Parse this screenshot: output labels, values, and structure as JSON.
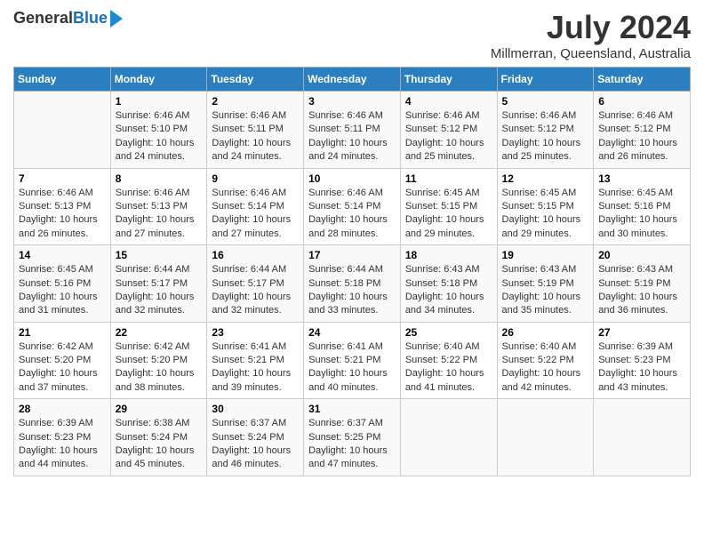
{
  "header": {
    "logo_general": "General",
    "logo_blue": "Blue",
    "month_title": "July 2024",
    "location": "Millmerran, Queensland, Australia"
  },
  "days_of_week": [
    "Sunday",
    "Monday",
    "Tuesday",
    "Wednesday",
    "Thursday",
    "Friday",
    "Saturday"
  ],
  "weeks": [
    [
      {
        "day": "",
        "info": ""
      },
      {
        "day": "1",
        "info": "Sunrise: 6:46 AM\nSunset: 5:10 PM\nDaylight: 10 hours\nand 24 minutes."
      },
      {
        "day": "2",
        "info": "Sunrise: 6:46 AM\nSunset: 5:11 PM\nDaylight: 10 hours\nand 24 minutes."
      },
      {
        "day": "3",
        "info": "Sunrise: 6:46 AM\nSunset: 5:11 PM\nDaylight: 10 hours\nand 24 minutes."
      },
      {
        "day": "4",
        "info": "Sunrise: 6:46 AM\nSunset: 5:12 PM\nDaylight: 10 hours\nand 25 minutes."
      },
      {
        "day": "5",
        "info": "Sunrise: 6:46 AM\nSunset: 5:12 PM\nDaylight: 10 hours\nand 25 minutes."
      },
      {
        "day": "6",
        "info": "Sunrise: 6:46 AM\nSunset: 5:12 PM\nDaylight: 10 hours\nand 26 minutes."
      }
    ],
    [
      {
        "day": "7",
        "info": "Sunrise: 6:46 AM\nSunset: 5:13 PM\nDaylight: 10 hours\nand 26 minutes."
      },
      {
        "day": "8",
        "info": "Sunrise: 6:46 AM\nSunset: 5:13 PM\nDaylight: 10 hours\nand 27 minutes."
      },
      {
        "day": "9",
        "info": "Sunrise: 6:46 AM\nSunset: 5:14 PM\nDaylight: 10 hours\nand 27 minutes."
      },
      {
        "day": "10",
        "info": "Sunrise: 6:46 AM\nSunset: 5:14 PM\nDaylight: 10 hours\nand 28 minutes."
      },
      {
        "day": "11",
        "info": "Sunrise: 6:45 AM\nSunset: 5:15 PM\nDaylight: 10 hours\nand 29 minutes."
      },
      {
        "day": "12",
        "info": "Sunrise: 6:45 AM\nSunset: 5:15 PM\nDaylight: 10 hours\nand 29 minutes."
      },
      {
        "day": "13",
        "info": "Sunrise: 6:45 AM\nSunset: 5:16 PM\nDaylight: 10 hours\nand 30 minutes."
      }
    ],
    [
      {
        "day": "14",
        "info": "Sunrise: 6:45 AM\nSunset: 5:16 PM\nDaylight: 10 hours\nand 31 minutes."
      },
      {
        "day": "15",
        "info": "Sunrise: 6:44 AM\nSunset: 5:17 PM\nDaylight: 10 hours\nand 32 minutes."
      },
      {
        "day": "16",
        "info": "Sunrise: 6:44 AM\nSunset: 5:17 PM\nDaylight: 10 hours\nand 32 minutes."
      },
      {
        "day": "17",
        "info": "Sunrise: 6:44 AM\nSunset: 5:18 PM\nDaylight: 10 hours\nand 33 minutes."
      },
      {
        "day": "18",
        "info": "Sunrise: 6:43 AM\nSunset: 5:18 PM\nDaylight: 10 hours\nand 34 minutes."
      },
      {
        "day": "19",
        "info": "Sunrise: 6:43 AM\nSunset: 5:19 PM\nDaylight: 10 hours\nand 35 minutes."
      },
      {
        "day": "20",
        "info": "Sunrise: 6:43 AM\nSunset: 5:19 PM\nDaylight: 10 hours\nand 36 minutes."
      }
    ],
    [
      {
        "day": "21",
        "info": "Sunrise: 6:42 AM\nSunset: 5:20 PM\nDaylight: 10 hours\nand 37 minutes."
      },
      {
        "day": "22",
        "info": "Sunrise: 6:42 AM\nSunset: 5:20 PM\nDaylight: 10 hours\nand 38 minutes."
      },
      {
        "day": "23",
        "info": "Sunrise: 6:41 AM\nSunset: 5:21 PM\nDaylight: 10 hours\nand 39 minutes."
      },
      {
        "day": "24",
        "info": "Sunrise: 6:41 AM\nSunset: 5:21 PM\nDaylight: 10 hours\nand 40 minutes."
      },
      {
        "day": "25",
        "info": "Sunrise: 6:40 AM\nSunset: 5:22 PM\nDaylight: 10 hours\nand 41 minutes."
      },
      {
        "day": "26",
        "info": "Sunrise: 6:40 AM\nSunset: 5:22 PM\nDaylight: 10 hours\nand 42 minutes."
      },
      {
        "day": "27",
        "info": "Sunrise: 6:39 AM\nSunset: 5:23 PM\nDaylight: 10 hours\nand 43 minutes."
      }
    ],
    [
      {
        "day": "28",
        "info": "Sunrise: 6:39 AM\nSunset: 5:23 PM\nDaylight: 10 hours\nand 44 minutes."
      },
      {
        "day": "29",
        "info": "Sunrise: 6:38 AM\nSunset: 5:24 PM\nDaylight: 10 hours\nand 45 minutes."
      },
      {
        "day": "30",
        "info": "Sunrise: 6:37 AM\nSunset: 5:24 PM\nDaylight: 10 hours\nand 46 minutes."
      },
      {
        "day": "31",
        "info": "Sunrise: 6:37 AM\nSunset: 5:25 PM\nDaylight: 10 hours\nand 47 minutes."
      },
      {
        "day": "",
        "info": ""
      },
      {
        "day": "",
        "info": ""
      },
      {
        "day": "",
        "info": ""
      }
    ]
  ]
}
